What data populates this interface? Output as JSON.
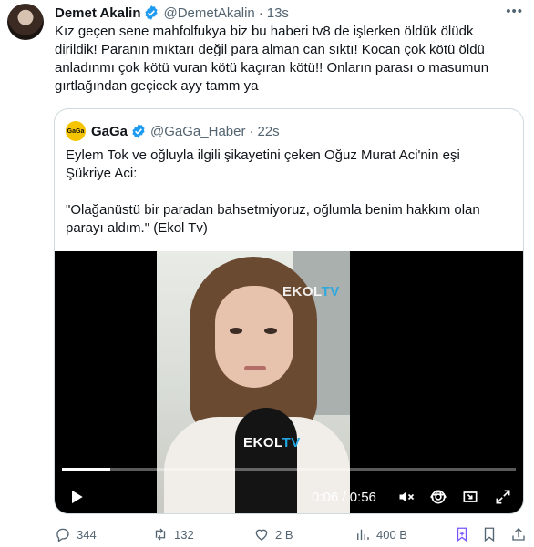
{
  "tweet": {
    "author_name": "Demet Akalin",
    "author_handle": "@DemetAkalin",
    "separator": "·",
    "time": "13s",
    "text": "Kız geçen sene mahfolfukya biz bu haberi tv8 de işlerken öldük ölüdk\ndirildik! Paranın mıktarı değil para alman can sıktı! Kocan çok kötü öldü\nanladınmı çok kötü vuran kötü kaçıran kötü!! Onların parası o masumun\ngırtlağından geçicek ayy tamm ya"
  },
  "quote": {
    "author_name": "GaGa",
    "avatar_text": "GaGa",
    "author_handle": "@GaGa_Haber",
    "separator": "·",
    "time": "22s",
    "text": "Eylem Tok ve oğluyla ilgili şikayetini çeken Oğuz Murat Aci'nin eşi\nŞükriye Aci:\n\n\"Olağanüstü bir paradan bahsetmiyoruz, oğlumla benim hakkım olan\nparayı aldım.\" (Ekol Tv)"
  },
  "video": {
    "watermark_brand": "EKOL",
    "watermark_suffix": "TV",
    "mic_brand": "EKOL",
    "mic_suffix": "TV",
    "timecode": "0:06 / 0:56",
    "progress_fraction": 0.107
  },
  "actions": {
    "replies": "344",
    "retweets": "132",
    "likes": "2 B",
    "views": "400 B"
  },
  "icons": {
    "verified": "verified-badge-icon",
    "more": "more-icon",
    "play": "play-icon",
    "mute": "mute-icon",
    "settings": "settings-icon",
    "pip": "picture-in-picture-icon",
    "fullscreen": "fullscreen-icon",
    "reply": "reply-icon",
    "retweet": "retweet-icon",
    "like": "like-icon",
    "views": "views-icon",
    "bookmark": "bookmark-icon",
    "share": "share-icon"
  },
  "colors": {
    "verified_blue": "#1d9bf0",
    "secondary_text": "#536471",
    "bookmark_purple": "#7856ff",
    "gaga_yellow": "#f5c400",
    "ekol_tv_blue": "#21a8e4"
  }
}
